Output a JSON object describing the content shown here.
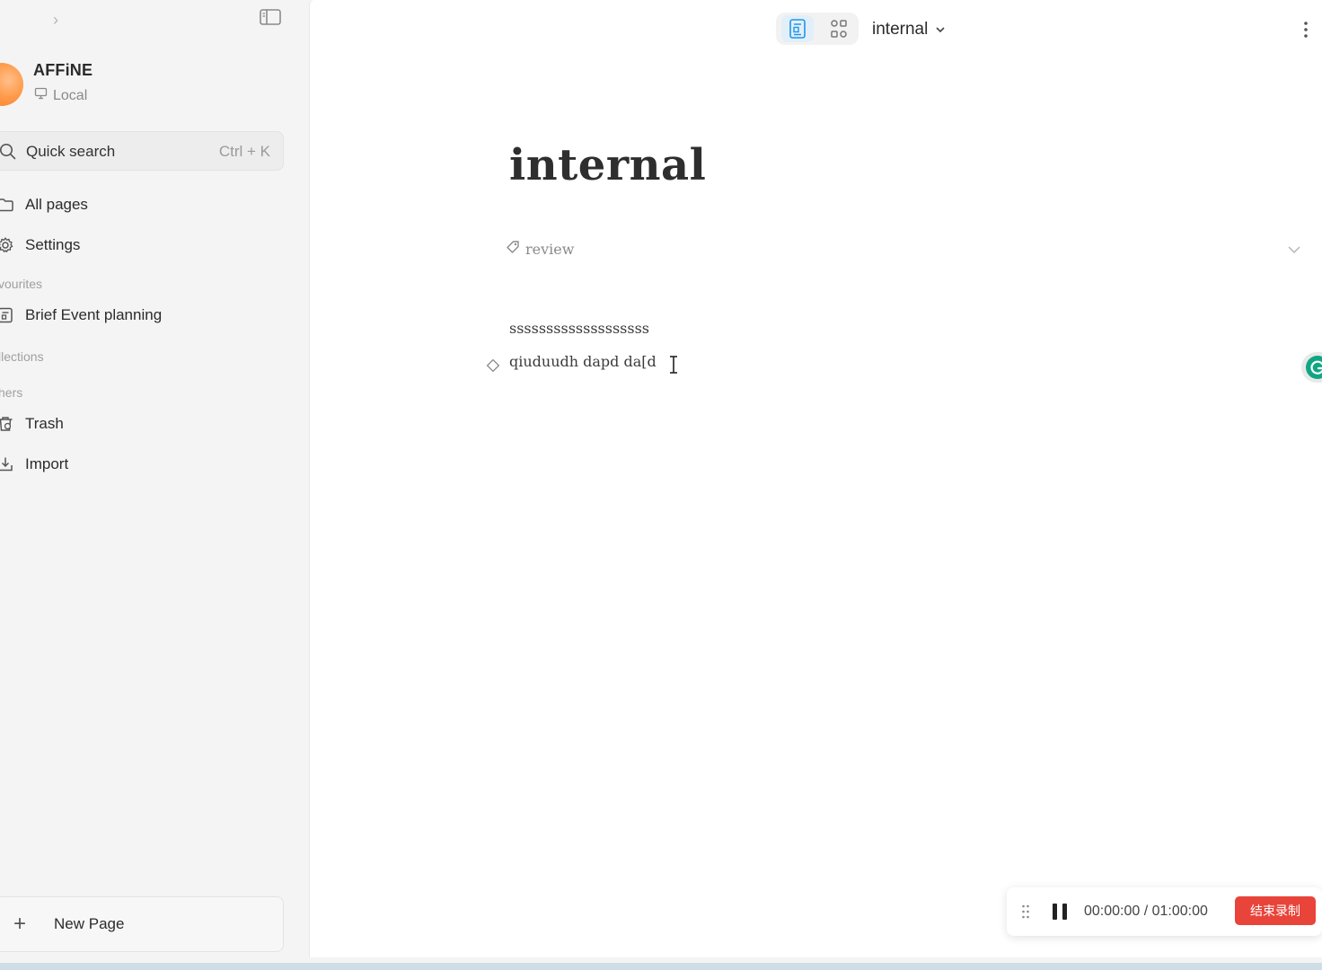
{
  "sidebar": {
    "workspace": {
      "name": "AFFiNE",
      "storage": "Local"
    },
    "search": {
      "label": "Quick search",
      "shortcut": "Ctrl + K"
    },
    "nav": [
      {
        "label": "All pages",
        "icon": "folder-icon"
      },
      {
        "label": "Settings",
        "icon": "gear-icon"
      }
    ],
    "sections": {
      "favourites": "vourites",
      "collections": "llections",
      "others": "hers"
    },
    "favourites": [
      {
        "label": "Brief Event planning",
        "icon": "page-icon"
      }
    ],
    "others": [
      {
        "label": "Trash",
        "icon": "trash-icon"
      },
      {
        "label": "Import",
        "icon": "import-icon"
      }
    ],
    "new_page": "New Page"
  },
  "header": {
    "doc_title": "internal"
  },
  "doc": {
    "title": "internal",
    "tag": "review",
    "paragraphs": [
      "sssssssssssssssssss",
      "qiuduudh dapd da[d"
    ]
  },
  "recorder": {
    "time": "00:00:00 / 01:00:00",
    "stop_label": "结束录制"
  },
  "colors": {
    "accent": "#1e96eb",
    "stop": "#e8443a",
    "avatar": "#ff9a4a",
    "grammarly": "#11a683"
  }
}
